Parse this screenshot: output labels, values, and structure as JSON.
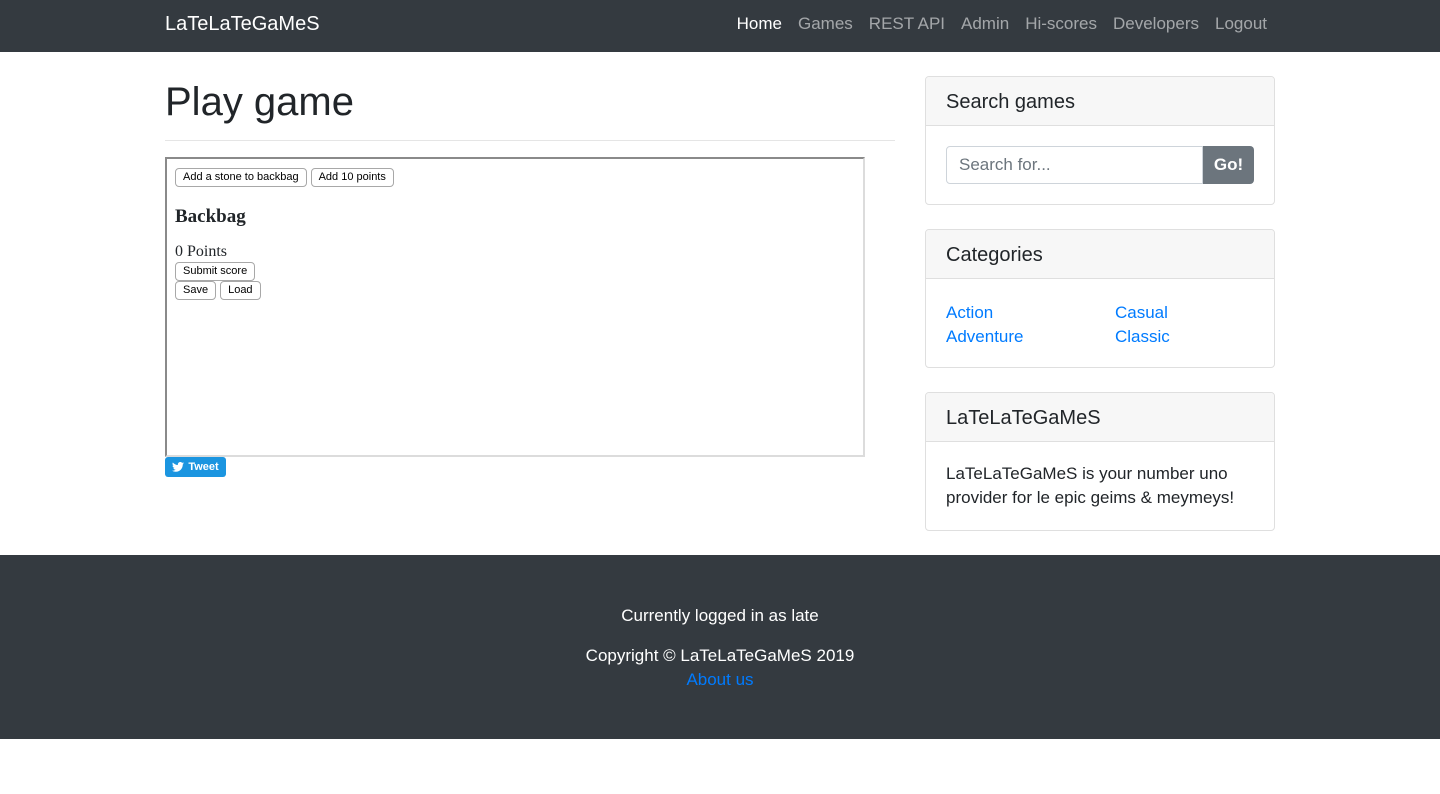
{
  "navbar": {
    "brand": "LaTeLaTeGaMeS",
    "links": [
      {
        "label": "Home",
        "active": true
      },
      {
        "label": "Games"
      },
      {
        "label": "REST API"
      },
      {
        "label": "Admin"
      },
      {
        "label": "Hi-scores"
      },
      {
        "label": "Developers"
      },
      {
        "label": "Logout"
      }
    ]
  },
  "main": {
    "title": "Play game",
    "game": {
      "add_stone_label": "Add a stone to backbag",
      "add_points_label": "Add 10 points",
      "backbag_title": "Backbag",
      "points_text": "0 Points",
      "submit_label": "Submit score",
      "save_label": "Save",
      "load_label": "Load"
    },
    "tweet_label": "Tweet"
  },
  "sidebar": {
    "search": {
      "title": "Search games",
      "placeholder": "Search for...",
      "button_label": "Go!"
    },
    "categories": {
      "title": "Categories",
      "items": [
        "Action",
        "Casual",
        "Adventure",
        "Classic"
      ]
    },
    "about": {
      "title": "LaTeLaTeGaMeS",
      "text": "LaTeLaTeGaMeS is your number uno provider for le epic geims & meymeys!"
    }
  },
  "footer": {
    "logged_in": "Currently logged in as late",
    "copyright": "Copyright © LaTeLaTeGaMeS 2019",
    "about_link": "About us"
  },
  "colors": {
    "navbar_bg": "#343a40",
    "link": "#007bff",
    "go_button": "#6c757d",
    "tweet": "#1b95e0"
  }
}
